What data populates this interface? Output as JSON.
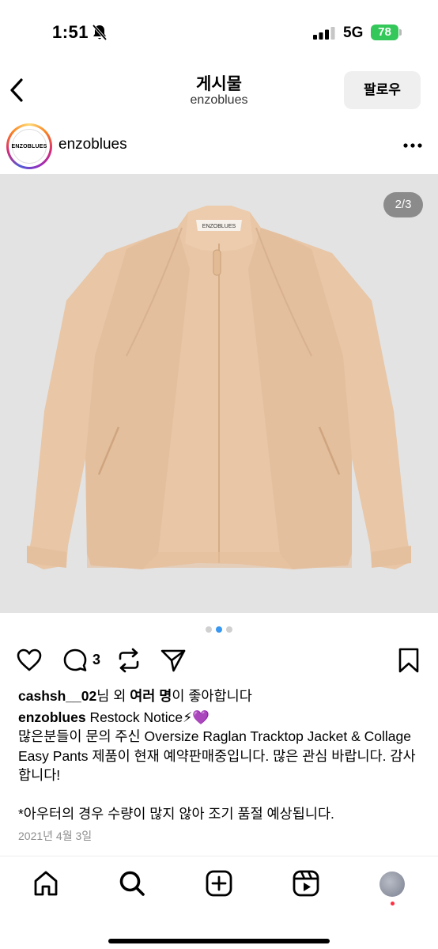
{
  "status_bar": {
    "time": "1:51",
    "network": "5G",
    "battery": "78"
  },
  "header": {
    "title": "게시물",
    "subtitle": "enzoblues",
    "follow_label": "팔로우"
  },
  "post": {
    "username": "enzoblues",
    "avatar_logo_text": "ENZOBLUES",
    "image_counter": "2/3",
    "image_brand_label": "ENZOBLUES",
    "carousel": {
      "total": 3,
      "active": 2
    },
    "comment_count": "3",
    "likes": {
      "prefix": "cashsh__02",
      "middle": "님 외 ",
      "bold": "여러 명",
      "suffix": "이 좋아합니다"
    },
    "caption": {
      "author": "enzoblues",
      "headline": " Restock Notice⚡💜",
      "body": "많은분들이 문의 주신 Oversize Raglan Tracktop Jacket & Collage Easy Pants 제품이 현재 예약판매중입니다. 많은 관심 바랍니다. 감사합니다!",
      "note": "*아우터의 경우 수량이 많지 않아 조기 품절 예상됩니다."
    },
    "date": "2021년 4월 3일"
  },
  "icons": {
    "back": "chevron-left-icon",
    "more": "more-horizontal-icon",
    "like": "heart-icon",
    "comment": "comment-icon",
    "repost": "repost-icon",
    "share": "send-icon",
    "save": "bookmark-icon",
    "home": "home-icon",
    "search": "search-icon",
    "create": "plus-square-icon",
    "reels": "reels-icon"
  },
  "colors": {
    "battery": "#34c759",
    "accent_dot": "#3897f0",
    "notification": "#ff3040",
    "jacket": "#e9c8a8"
  }
}
